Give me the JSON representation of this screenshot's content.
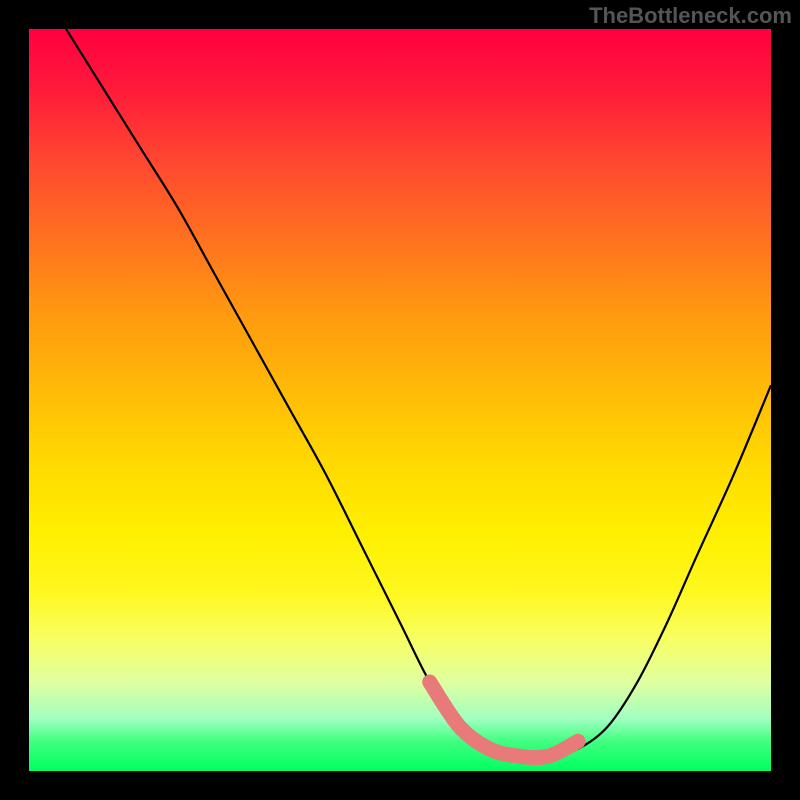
{
  "watermark": "TheBottleneck.com",
  "chart_data": {
    "type": "line",
    "title": "",
    "xlabel": "",
    "ylabel": "",
    "xlim": [
      0,
      100
    ],
    "ylim": [
      0,
      100
    ],
    "series": [
      {
        "name": "curve",
        "x": [
          5,
          10,
          15,
          20,
          25,
          30,
          35,
          40,
          45,
          50,
          54,
          58,
          62,
          66,
          70,
          74,
          78,
          82,
          86,
          90,
          95,
          100
        ],
        "y": [
          100,
          92,
          84,
          76,
          67,
          58,
          49,
          40,
          30,
          20,
          12,
          6,
          3,
          2,
          2,
          3,
          6,
          12,
          20,
          29,
          40,
          52
        ]
      },
      {
        "name": "highlight",
        "x": [
          54,
          58,
          62,
          66,
          70,
          74
        ],
        "y": [
          12,
          6,
          3,
          2,
          2,
          4
        ]
      }
    ]
  }
}
